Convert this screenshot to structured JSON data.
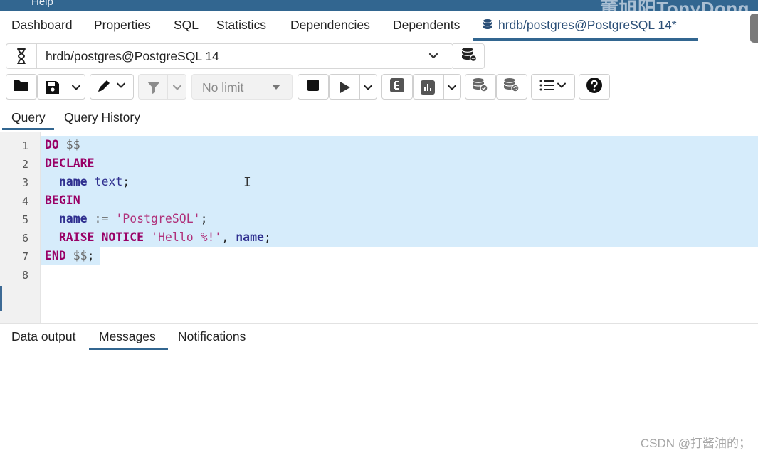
{
  "menubar": {
    "items": [
      "Help"
    ],
    "watermark": "董旭阳TonyDong"
  },
  "tabs": [
    {
      "label": "Dashboard"
    },
    {
      "label": "Properties"
    },
    {
      "label": "SQL"
    },
    {
      "label": "Statistics"
    },
    {
      "label": "Dependencies"
    },
    {
      "label": "Dependents"
    },
    {
      "label": "hrdb/postgres@PostgreSQL 14*",
      "icon": "database-icon",
      "active": true
    }
  ],
  "connection": {
    "value": "hrdb/postgres@PostgreSQL 14",
    "status_icon": "hourglass-icon"
  },
  "toolbar": {
    "row_limit": "No limit"
  },
  "query_tabs": [
    {
      "label": "Query",
      "active": true
    },
    {
      "label": "Query History"
    }
  ],
  "editor": {
    "line_numbers": [
      "1",
      "2",
      "3",
      "4",
      "5",
      "6",
      "7",
      "8"
    ],
    "lines": [
      [
        {
          "t": "DO",
          "c": "kw"
        },
        {
          "t": " $$",
          "c": "op"
        }
      ],
      [
        {
          "t": "DECLARE",
          "c": "kw"
        }
      ],
      [
        {
          "t": "  "
        },
        {
          "t": "name",
          "c": "id"
        },
        {
          "t": " text",
          "c": "ty"
        },
        {
          "t": ";"
        }
      ],
      [
        {
          "t": "BEGIN",
          "c": "kw"
        }
      ],
      [
        {
          "t": "  "
        },
        {
          "t": "name",
          "c": "id"
        },
        {
          "t": " := ",
          "c": "op"
        },
        {
          "t": "'PostgreSQL'",
          "c": "st"
        },
        {
          "t": ";"
        }
      ],
      [
        {
          "t": "  "
        },
        {
          "t": "RAISE",
          "c": "kw"
        },
        {
          "t": " "
        },
        {
          "t": "NOTICE",
          "c": "kw"
        },
        {
          "t": " "
        },
        {
          "t": "'Hello %!'",
          "c": "st"
        },
        {
          "t": ", "
        },
        {
          "t": "name",
          "c": "id"
        },
        {
          "t": ";"
        }
      ],
      [
        {
          "t": "END",
          "c": "kw"
        },
        {
          "t": " $$",
          "c": "op"
        },
        {
          "t": ";"
        }
      ],
      []
    ]
  },
  "result_tabs": [
    {
      "label": "Data output"
    },
    {
      "label": "Messages",
      "active": true
    },
    {
      "label": "Notifications"
    }
  ],
  "footer_watermark": "CSDN @打酱油的；",
  "colors": {
    "accent": "#326690",
    "selection": "#d6ecfb",
    "keyword": "#990066",
    "string": "#b0317a"
  }
}
